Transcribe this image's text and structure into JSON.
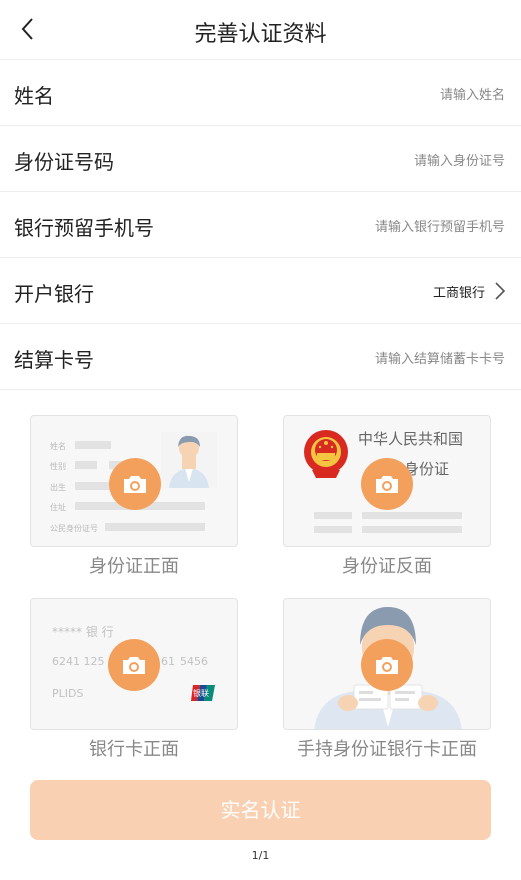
{
  "header": {
    "title": "完善认证资料",
    "back_icon": "chevron-left-icon"
  },
  "form": {
    "name": {
      "label": "姓名",
      "placeholder": "请输入姓名"
    },
    "id_number": {
      "label": "身份证号码",
      "placeholder": "请输入身份证号"
    },
    "phone": {
      "label": "银行预留手机号",
      "placeholder": "请输入银行预留手机号"
    },
    "bank": {
      "label": "开户银行",
      "value": "工商银行"
    },
    "card_number": {
      "label": "结算卡号",
      "placeholder": "请输入结算储蓄卡卡号"
    }
  },
  "uploads": {
    "id_front": {
      "caption": "身份证正面",
      "field_labels": [
        "姓名",
        "性别",
        "出生",
        "住址",
        "公民身份证号"
      ]
    },
    "id_back": {
      "caption": "身份证反面",
      "line1": "中华人民共和国",
      "line2": "居民身份证"
    },
    "bank_front": {
      "caption": "银行卡正面",
      "bank_text": "***** 银 行",
      "number_left": "6241 125",
      "number_mid": "61",
      "number_right": "5456",
      "holder": "PLIDS",
      "union_logo": "银联"
    },
    "handheld": {
      "caption": "手持身份证银行卡正面"
    }
  },
  "submit_label": "实名认证",
  "pager": "1/1",
  "colors": {
    "accent": "#f4a05d",
    "button": "#fad0b3",
    "placeholder": "#888888"
  }
}
